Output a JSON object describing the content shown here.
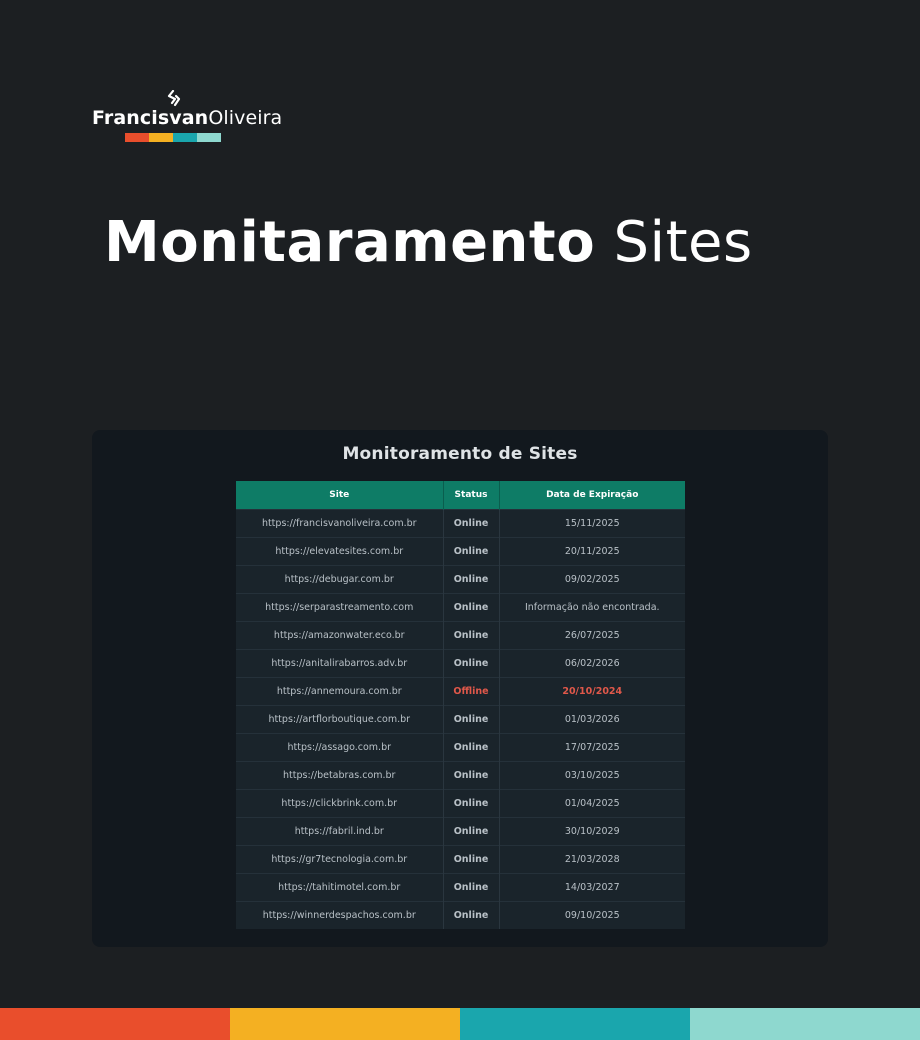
{
  "brand": {
    "first": "Francisvan",
    "last": "Oliveira",
    "palette": [
      "#e94e2c",
      "#f4b022",
      "#1aa6ad",
      "#8ed8cf"
    ]
  },
  "headline": {
    "bold": "Monitaramento",
    "light": "Sites"
  },
  "monitor": {
    "title": "Monitoramento de Sites",
    "columns": [
      "Site",
      "Status",
      "Data de Expiração"
    ],
    "rows": [
      {
        "site": "https://francisvanoliveira.com.br",
        "status": "Online",
        "date": "15/11/2025"
      },
      {
        "site": "https://elevatesites.com.br",
        "status": "Online",
        "date": "20/11/2025"
      },
      {
        "site": "https://debugar.com.br",
        "status": "Online",
        "date": "09/02/2025"
      },
      {
        "site": "https://serparastreamento.com",
        "status": "Online",
        "date": "Informação não encontrada."
      },
      {
        "site": "https://amazonwater.eco.br",
        "status": "Online",
        "date": "26/07/2025"
      },
      {
        "site": "https://anitalirabarros.adv.br",
        "status": "Online",
        "date": "06/02/2026"
      },
      {
        "site": "https://annemoura.com.br",
        "status": "Offline",
        "date": "20/10/2024"
      },
      {
        "site": "https://artflorboutique.com.br",
        "status": "Online",
        "date": "01/03/2026"
      },
      {
        "site": "https://assago.com.br",
        "status": "Online",
        "date": "17/07/2025"
      },
      {
        "site": "https://betabras.com.br",
        "status": "Online",
        "date": "03/10/2025"
      },
      {
        "site": "https://clickbrink.com.br",
        "status": "Online",
        "date": "01/04/2025"
      },
      {
        "site": "https://fabril.ind.br",
        "status": "Online",
        "date": "30/10/2029"
      },
      {
        "site": "https://gr7tecnologia.com.br",
        "status": "Online",
        "date": "21/03/2028"
      },
      {
        "site": "https://tahitimotel.com.br",
        "status": "Online",
        "date": "14/03/2027"
      },
      {
        "site": "https://winnerdespachos.com.br",
        "status": "Online",
        "date": "09/10/2025"
      }
    ]
  },
  "colors": {
    "background": "#1c1f22",
    "table_header": "#0e7c66",
    "online": "#4fb969",
    "offline": "#e0584a"
  }
}
